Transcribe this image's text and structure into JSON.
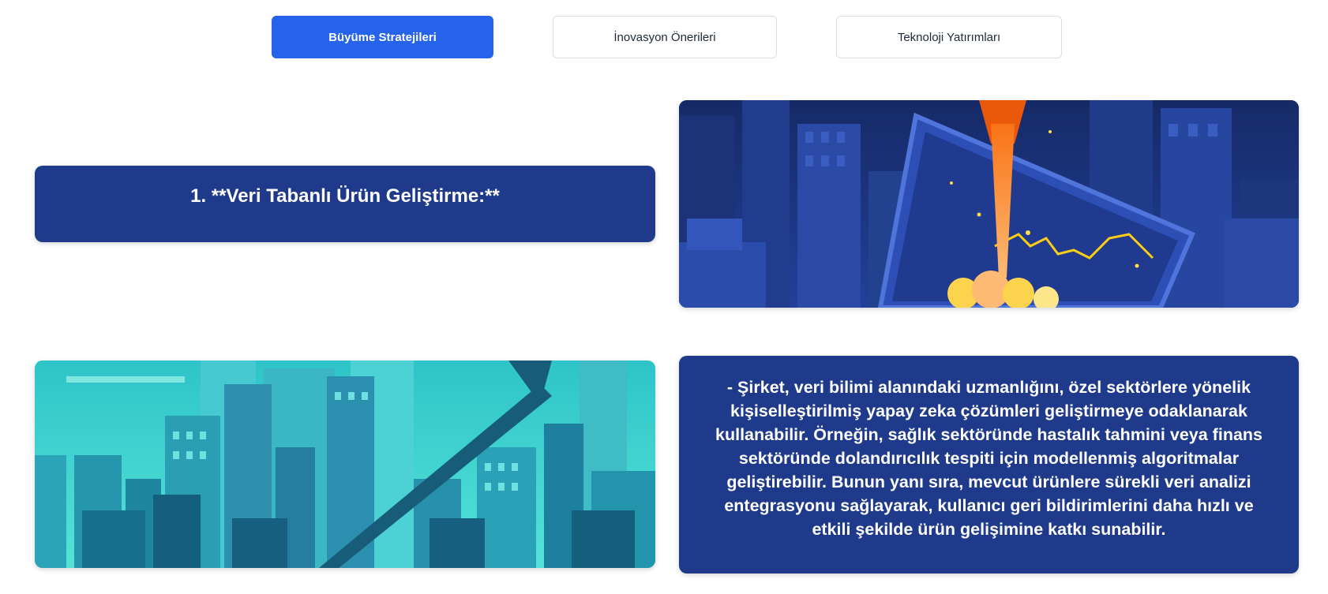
{
  "tabs": [
    {
      "label": "Büyüme Stratejileri",
      "active": true
    },
    {
      "label": "İnovasyon Önerileri",
      "active": false
    },
    {
      "label": "Teknoloji Yatırımları",
      "active": false
    }
  ],
  "section": {
    "title": "1. **Veri Tabanlı Ürün Geliştirme:**",
    "body": "- Şirket, veri bilimi alanındaki uzmanlığını, özel sektörlere yönelik kişiselleştirilmiş yapay zeka çözümleri geliştirmeye odaklanarak kullanabilir. Örneğin, sağlık sektöründe hastalık tahmini veya finans sektöründe dolandırıcılık tespiti için modellenmiş algoritmalar geliştirebilir. Bunun yanı sıra, mevcut ürünlere sürekli veri analizi entegrasyonu sağlayarak, kullanıcı geri bildirimlerini daha hızlı ve etkili şekilde ürün gelişimine katkı sunabilir."
  },
  "colors": {
    "accent": "#2563eb",
    "card_bg": "#1f3a8a",
    "rocket_bg": "#1b2f6e",
    "city_bg": "#39d5d2"
  },
  "images": {
    "rocket": "rocket-launch-city-illustration",
    "city": "growth-arrow-city-illustration"
  }
}
